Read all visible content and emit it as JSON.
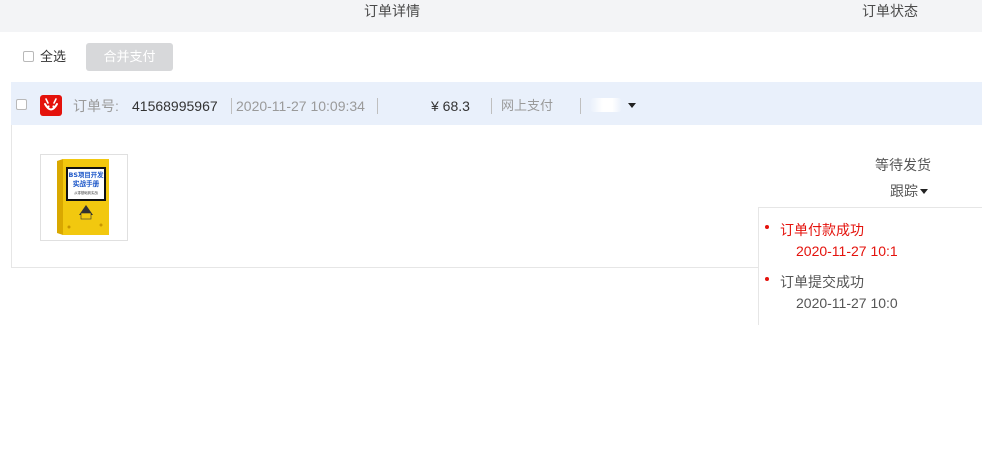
{
  "header": {
    "col_detail": "订单详情",
    "col_status": "订单状态"
  },
  "toolbar": {
    "select_all_label": "全选",
    "merge_pay_label": "合并支付"
  },
  "order": {
    "order_no_label": "订单号:",
    "order_no": "41568995967",
    "time": "2020-11-27 10:09:34",
    "amount": "¥ 68.3",
    "pay_method": "网上支付",
    "status": "等待发货",
    "track_label": "跟踪",
    "product": {
      "cover_title": "BS项目开发",
      "cover_subtitle": "实战手册",
      "cover_tag": "从零基础到实战"
    }
  },
  "tracking": {
    "events": [
      {
        "title": "订单付款成功",
        "time": "2020-11-27 10:1",
        "highlight": true
      },
      {
        "title": "订单提交成功",
        "time": "2020-11-27 10:0",
        "highlight": false
      }
    ]
  },
  "colors": {
    "accent_red": "#e4120c",
    "event_red": "#e4120c",
    "header_bg": "#f3f4f6",
    "order_head_bg": "#e9f0fb",
    "button_disabled_bg": "#d7d8da"
  },
  "icons": {
    "shop": "jd-shop-icon",
    "caret": "caret-down-icon"
  }
}
